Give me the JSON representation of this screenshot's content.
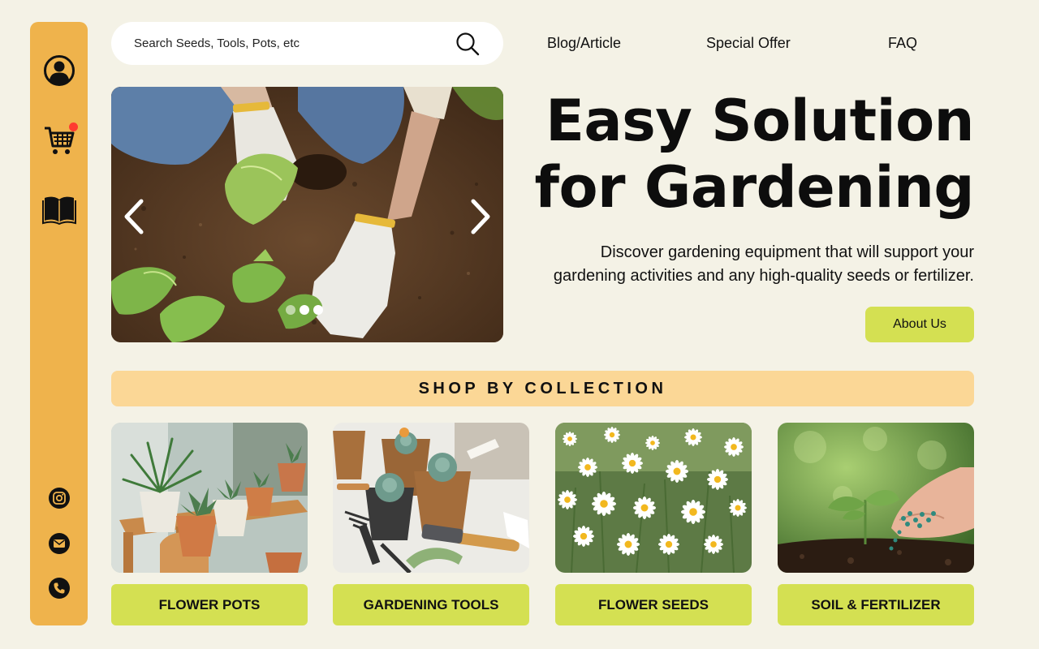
{
  "search": {
    "placeholder": "Search Seeds, Tools, Pots, etc",
    "icon": "search-icon"
  },
  "nav": {
    "items": [
      {
        "label": "Blog/Article"
      },
      {
        "label": "Special Offer"
      },
      {
        "label": "FAQ"
      }
    ]
  },
  "sidebar": {
    "top_icons": [
      "user-profile-icon",
      "shopping-cart-icon",
      "book-icon"
    ],
    "bottom_icons": [
      "instagram-icon",
      "mail-icon",
      "phone-icon"
    ],
    "cart_has_notification": true
  },
  "hero": {
    "title_line1": "Easy Solution",
    "title_line2": "for Gardening",
    "description_line1": "Discover gardening equipment that will support your",
    "description_line2": "gardening activities and any high-quality seeds or fertilizer.",
    "about_button": "About Us",
    "slider": {
      "slide_count": 3,
      "active_slide": 2
    }
  },
  "collection": {
    "heading": "SHOP BY COLLECTION",
    "items": [
      {
        "label": "FLOWER POTS"
      },
      {
        "label": "GARDENING TOOLS"
      },
      {
        "label": "FLOWER SEEDS"
      },
      {
        "label": "SOIL & FERTILIZER"
      }
    ]
  },
  "colors": {
    "background": "#f4f2e6",
    "sidebar": "#efb34c",
    "accent_green": "#d4e052",
    "banner": "#fbd796",
    "notification": "#ff3b30"
  }
}
